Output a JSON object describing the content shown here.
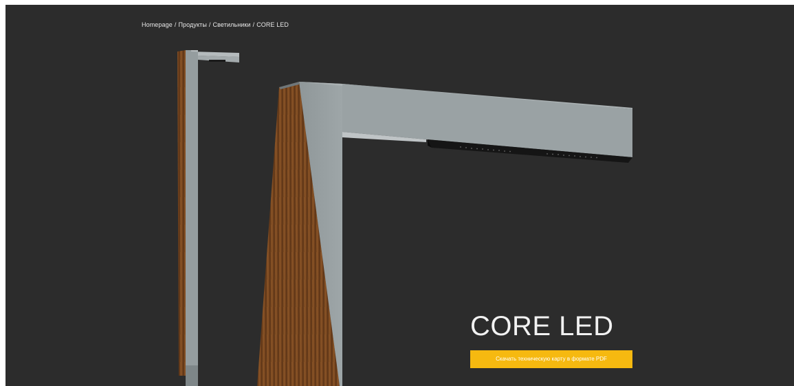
{
  "breadcrumb": {
    "items": [
      "Homepage",
      "Продукты",
      "Светильники",
      "CORE LED"
    ],
    "separator": "/"
  },
  "product": {
    "title": "CORE LED",
    "download_label": "Скачать техническую карту в формате PDF"
  },
  "colors": {
    "background": "#2c2c2c",
    "accent": "#f6b910",
    "pole": "#98a0a2",
    "wood": "#7a4a22"
  }
}
